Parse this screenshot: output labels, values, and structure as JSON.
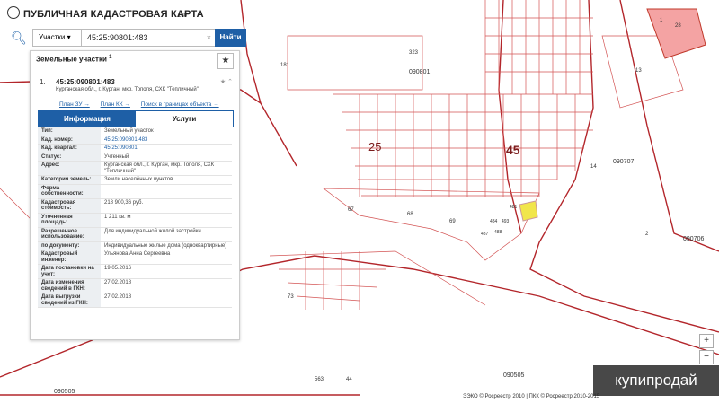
{
  "app": {
    "title": "ПУБЛИЧНАЯ КАДАСТРОВАЯ КАРТА"
  },
  "search": {
    "type_label": "Участки",
    "query": "45:25:90801:483",
    "find_label": "Найти"
  },
  "panel": {
    "title": "Земельные участки",
    "title_sup": "1"
  },
  "item": {
    "num": "1.",
    "id": "45:25:090801:483",
    "address": "Курганская обл., г. Курган, мкр. Тополя, СХК \"Тепличный\"",
    "links": [
      "План ЗУ →",
      "План КК →",
      "Поиск в границах объекта →"
    ]
  },
  "tabs": [
    "Информация",
    "Услуги"
  ],
  "details": [
    {
      "k": "Тип:",
      "v": "Земельный участок"
    },
    {
      "k": "Кад. номер:",
      "v": "45:25:090801:483",
      "link": true
    },
    {
      "k": "Кад. квартал:",
      "v": "45:25:090801",
      "link": true
    },
    {
      "k": "Статус:",
      "v": "Учтенный"
    },
    {
      "k": "Адрес:",
      "v": "Курганская обл., г. Курган, мкр. Тополя, СХК \"Тепличный\""
    },
    {
      "k": "Категория земель:",
      "v": "Земли населённых пунктов"
    },
    {
      "k": "Форма собственности:",
      "v": "-"
    },
    {
      "k": "Кадастровая стоимость:",
      "v": "218 900,36 руб."
    },
    {
      "k": "Уточненная площадь:",
      "v": "1 211 кв. м"
    },
    {
      "k": "Разрешенное использование:",
      "v": "Для индивидуальной жилой застройки"
    },
    {
      "k": "по документу:",
      "v": "Индивидуальные жилые дома (одноквартирные)"
    },
    {
      "k": "Кадастровый инженер:",
      "v": "Ульянова Анна Сергеевна"
    },
    {
      "k": "Дата постановки на учет:",
      "v": "19.05.2016"
    },
    {
      "k": "Дата изменения сведений в ГКН:",
      "v": "27.02.2018"
    },
    {
      "k": "Дата выгрузки сведений из ГКН:",
      "v": "27.02.2018"
    }
  ],
  "map_labels": {
    "big_25": "25",
    "big_45": "45",
    "q090801": "090801",
    "q090707": "090707",
    "q090706": "090706",
    "q090505a": "090505",
    "q090505b": "090505",
    "n181": "181",
    "n180": "180",
    "n323": "323",
    "n13": "13",
    "n14": "14",
    "n2": "2",
    "n67": "67",
    "n68": "68",
    "n69": "69",
    "n73": "73",
    "n44": "44",
    "n563": "563",
    "n28": "28",
    "n1": "1",
    "n481": "481",
    "n484": "484",
    "n493": "493",
    "n487": "487",
    "n488": "488"
  },
  "zoom": {
    "in": "+",
    "out": "−"
  },
  "copyright": "ЭЭКО © Росреестр 2010 | ПКК © Росреестр 2010-2015",
  "watermark": "купипродай",
  "colors": {
    "accent": "#1e5fa6",
    "parcel_line": "#c0392b",
    "highlight": "#f1e64b",
    "pink": "#f4a3a3"
  }
}
